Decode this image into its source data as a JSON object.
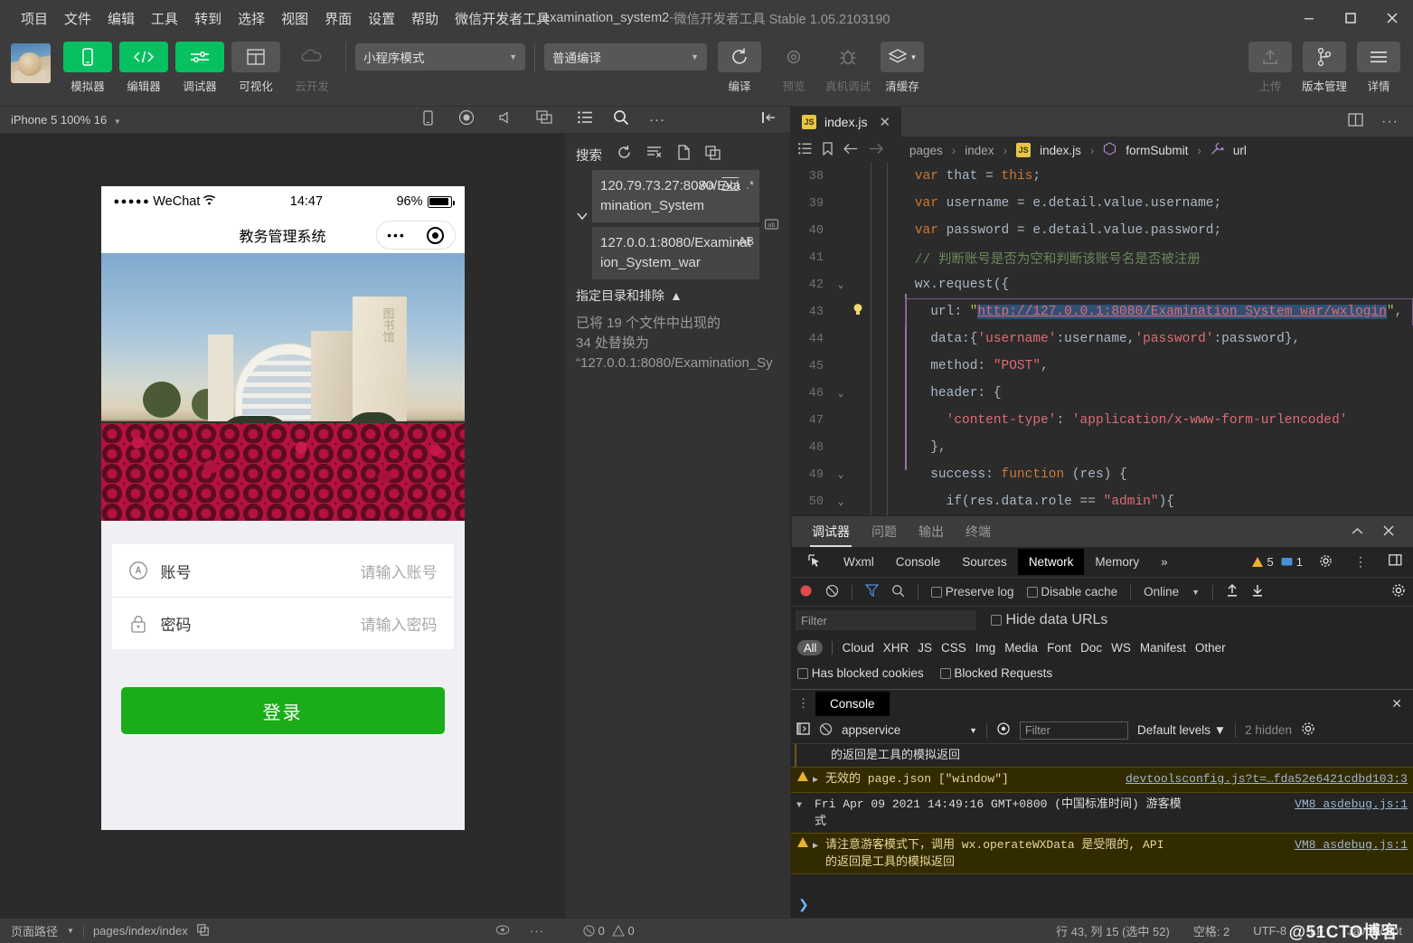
{
  "titlebar": {
    "menus": [
      "项目",
      "文件",
      "编辑",
      "工具",
      "转到",
      "选择",
      "视图",
      "界面",
      "设置",
      "帮助",
      "微信开发者工具"
    ],
    "project": "examination_system2",
    "dash": " - ",
    "app_version": "微信开发者工具 Stable 1.05.2103190"
  },
  "toolbar": {
    "buttons": [
      {
        "label": "模拟器",
        "icon": "phone-icon",
        "style": "green"
      },
      {
        "label": "编辑器",
        "icon": "code-icon",
        "style": "green"
      },
      {
        "label": "调试器",
        "icon": "sliders-icon",
        "style": "green"
      },
      {
        "label": "可视化",
        "icon": "layout-icon",
        "style": "grey"
      },
      {
        "label": "云开发",
        "icon": "cloud-icon",
        "style": "none"
      }
    ],
    "mode_select": "小程序模式",
    "compile_select": "普通编译",
    "actions": [
      {
        "label": "编译",
        "icon": "refresh-icon",
        "dim": false
      },
      {
        "label": "预览",
        "icon": "eye-icon",
        "dim": true
      },
      {
        "label": "真机调试",
        "icon": "bug-icon",
        "dim": true
      },
      {
        "label": "清缓存",
        "icon": "layers-icon",
        "dim": false
      }
    ],
    "right_actions": [
      {
        "label": "上传",
        "icon": "upload-icon",
        "dim": true
      },
      {
        "label": "版本管理",
        "icon": "branch-icon",
        "dim": false
      },
      {
        "label": "详情",
        "icon": "menu-icon",
        "dim": false
      }
    ]
  },
  "simulator": {
    "device": "iPhone 5 100% 16",
    "header_icons": [
      "rotate-icon",
      "record-icon",
      "volume-icon",
      "window-icon"
    ],
    "phone": {
      "carrier": "WeChat",
      "dots": "●●●●●",
      "time": "14:47",
      "battery": "96%",
      "nav_title": "教务管理系统",
      "capsule_dots": "•••",
      "fields": [
        {
          "icon": "account-icon",
          "label": "账号",
          "placeholder": "请输入账号"
        },
        {
          "icon": "lock-icon",
          "label": "密码",
          "placeholder": "请输入密码"
        }
      ],
      "login_button": "登录"
    }
  },
  "search_panel": {
    "head_icons": [
      "list-icon",
      "search-icon",
      "more-icon",
      "collapse-icon"
    ],
    "title": "搜索",
    "toolbar_icons": [
      "refresh-icon",
      "clear-icon",
      "new-file-icon",
      "copy-icon"
    ],
    "find_value": "120.79.73.27:8080/Examination_System",
    "replace_value": "127.0.0.1:8080/Examination_System_war",
    "find_icons": [
      "Aa",
      "Abl",
      ".*"
    ],
    "replace_icon": "replace-all-icon",
    "includes_toggle": "指定目录和排除",
    "result_lines": [
      "已将 19 个文件中出现的",
      "34 处替换为",
      "“127.0.0.1:8080/Examination_Sy"
    ]
  },
  "editor": {
    "tab": {
      "name": "index.js",
      "badge": "JS"
    },
    "tab_actions": [
      "split-editor-icon",
      "more-icon"
    ],
    "breadcrumb": [
      "pages",
      "index",
      "index.js",
      "formSubmit",
      "url"
    ],
    "breadcrumb_icons": [
      "outline-icon",
      "bookmark-icon",
      "back-arrow-icon",
      "forward-arrow-icon"
    ],
    "code_lines": [
      {
        "num": "38",
        "fold": "",
        "lamp": "",
        "segs": [
          {
            "t": "    ",
            "c": "v"
          },
          {
            "t": "var",
            "c": "k"
          },
          {
            "t": " that ",
            "c": "v"
          },
          {
            "t": "=",
            "c": "v"
          },
          {
            "t": " ",
            "c": "v"
          },
          {
            "t": "this",
            "c": "k"
          },
          {
            "t": ";",
            "c": "v"
          }
        ]
      },
      {
        "num": "39",
        "fold": "",
        "lamp": "",
        "segs": [
          {
            "t": "    ",
            "c": "v"
          },
          {
            "t": "var",
            "c": "k"
          },
          {
            "t": " username = e.detail.value.username;",
            "c": "v"
          }
        ]
      },
      {
        "num": "40",
        "fold": "",
        "lamp": "",
        "segs": [
          {
            "t": "    ",
            "c": "v"
          },
          {
            "t": "var",
            "c": "k"
          },
          {
            "t": " password = e.detail.value.password;",
            "c": "v"
          }
        ]
      },
      {
        "num": "41",
        "fold": "",
        "lamp": "",
        "segs": [
          {
            "t": "    // 判断账号是否为空和判断该账号名是否被注册",
            "c": "cm"
          }
        ]
      },
      {
        "num": "42",
        "fold": "v",
        "lamp": "",
        "segs": [
          {
            "t": "    wx.request({",
            "c": "v"
          }
        ]
      },
      {
        "num": "43",
        "fold": "",
        "lamp": "bulb",
        "segs": [
          {
            "t": "      url: ",
            "c": "v"
          },
          {
            "t": "\"",
            "c": "st"
          },
          {
            "t": "http://127.0.0.1:8080/Examination_System_war/wxlogin",
            "c": "urlsel"
          },
          {
            "t": "\"",
            "c": "st"
          },
          {
            "t": ",",
            "c": "v"
          }
        ]
      },
      {
        "num": "44",
        "fold": "",
        "lamp": "",
        "segs": [
          {
            "t": "      data:{",
            "c": "v"
          },
          {
            "t": "'username'",
            "c": "st2"
          },
          {
            "t": ":username,",
            "c": "v"
          },
          {
            "t": "'password'",
            "c": "st2"
          },
          {
            "t": ":password},",
            "c": "v"
          }
        ]
      },
      {
        "num": "45",
        "fold": "",
        "lamp": "",
        "segs": [
          {
            "t": "      method: ",
            "c": "v"
          },
          {
            "t": "\"POST\"",
            "c": "st2"
          },
          {
            "t": ",",
            "c": "v"
          }
        ]
      },
      {
        "num": "46",
        "fold": "v",
        "lamp": "",
        "segs": [
          {
            "t": "      header: {",
            "c": "v"
          }
        ]
      },
      {
        "num": "47",
        "fold": "",
        "lamp": "",
        "segs": [
          {
            "t": "        ",
            "c": "v"
          },
          {
            "t": "'content-type'",
            "c": "st2"
          },
          {
            "t": ": ",
            "c": "v"
          },
          {
            "t": "'application/x-www-form-urlencoded'",
            "c": "st2"
          }
        ]
      },
      {
        "num": "48",
        "fold": "",
        "lamp": "",
        "segs": [
          {
            "t": "      },",
            "c": "v"
          }
        ]
      },
      {
        "num": "49",
        "fold": "v",
        "lamp": "",
        "segs": [
          {
            "t": "      success: ",
            "c": "v"
          },
          {
            "t": "function",
            "c": "k"
          },
          {
            "t": " (res) {",
            "c": "v"
          }
        ]
      },
      {
        "num": "50",
        "fold": "v",
        "lamp": "",
        "segs": [
          {
            "t": "        if(res.data.role == ",
            "c": "v"
          },
          {
            "t": "\"admin\"",
            "c": "st2"
          },
          {
            "t": "){",
            "c": "v"
          }
        ]
      }
    ]
  },
  "devtools": {
    "panel_tabs": [
      {
        "label": "调试器",
        "active": true
      },
      {
        "label": "问题",
        "active": false
      },
      {
        "label": "输出",
        "active": false
      },
      {
        "label": "终端",
        "active": false
      }
    ],
    "panel_icons": [
      "chevron-up-icon",
      "close-icon"
    ],
    "cdt_tabs": [
      {
        "label": "Wxml",
        "active": false
      },
      {
        "label": "Console",
        "active": false
      },
      {
        "label": "Sources",
        "active": false
      },
      {
        "label": "Network",
        "active": true
      },
      {
        "label": "Memory",
        "active": false
      }
    ],
    "cdt_more": "»",
    "warning_count": "5",
    "message_count": "1",
    "network_toolbar": {
      "preserve_log": "Preserve log",
      "disable_cache": "Disable cache",
      "throttle": "Online"
    },
    "filter_placeholder": "Filter",
    "hide_data_urls": "Hide data URLs",
    "resource_types": [
      "All",
      "Cloud",
      "XHR",
      "JS",
      "CSS",
      "Img",
      "Media",
      "Font",
      "Doc",
      "WS",
      "Manifest",
      "Other"
    ],
    "blocked_checks": [
      "Has blocked cookies",
      "Blocked Requests"
    ]
  },
  "console": {
    "title": "Console",
    "context": "appservice",
    "filter_placeholder": "Filter",
    "levels": "Default levels",
    "hidden": "2 hidden",
    "lines": [
      {
        "type": "cont",
        "text": "的返回是工具的模拟返回",
        "source": ""
      },
      {
        "type": "warn",
        "text": "无效的 page.json [\"window\"]",
        "source": "devtoolsconfig.js?t=…fda52e6421cdbd103:3"
      },
      {
        "type": "plain",
        "text": "Fri Apr 09 2021 14:49:16 GMT+0800 (中国标准时间) 游客模",
        "text2": "式",
        "source": "VM8 asdebug.js:1"
      },
      {
        "type": "warn",
        "text": "请注意游客模式下，调用 wx.operateWXData 是受限的, API",
        "text2": "的返回是工具的模拟返回",
        "source": "VM8 asdebug.js:1"
      }
    ],
    "prompt": "❯"
  },
  "statusbar": {
    "page_path_label": "页面路径",
    "page_path": "pages/index/index",
    "copy_icon": "copy-icon",
    "eye_icon": "eye-icon",
    "more_icon": "more-icon",
    "error_count": "0",
    "warning_count": "0",
    "cursor": "行 43, 列 15 (选中 52)",
    "spaces": "空格: 2",
    "encoding": "UTF-8",
    "eol": "LF",
    "language": "JavaScript",
    "watermark": "@51CTO博客"
  },
  "colors": {
    "accent_green": "#07c160",
    "login_green": "#1aad19",
    "warn_yellow": "#e8c547",
    "link_blue": "#9eb6d0"
  }
}
